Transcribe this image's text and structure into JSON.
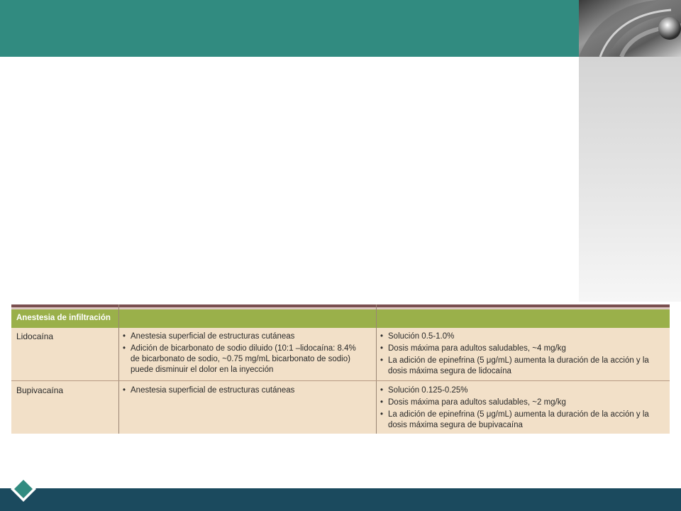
{
  "table": {
    "section_title": "Anestesia de infiltración",
    "rows": [
      {
        "drug": "Lidocaína",
        "uses": [
          "Anestesia superficial de estructuras cutáneas",
          "Adición de bicarbonato de sodio diluido (10:1 –lidocaína: 8.4% de bicarbonato de sodio, ~0.75 mg/mL bicarbonato de sodio) puede disminuir el dolor en la inyección"
        ],
        "notes": [
          "Solución 0.5-1.0%",
          "Dosis máxima para adultos saludables, ~4 mg/kg",
          "La adición de epinefrina (5 μg/mL) aumenta la duración de la acción y la dosis máxima segura de lidocaína"
        ]
      },
      {
        "drug": "Bupivacaína",
        "uses": [
          "Anestesia superficial de estructuras cutáneas"
        ],
        "notes": [
          "Solución 0.125-0.25%",
          "Dosis máxima para adultos saludables, ~2 mg/kg",
          "La adición de epinefrina (5 μg/mL) aumenta la duración de la acción y la dosis máxima segura de bupivacaína"
        ]
      }
    ]
  },
  "colors": {
    "header_bar": "#318b80",
    "footer_bar": "#1b4a5e",
    "section_header": "#9ab04a",
    "table_fill": "#f2e0c8"
  },
  "icons": [
    "metallic-corner-image",
    "diamond-logo-icon"
  ]
}
